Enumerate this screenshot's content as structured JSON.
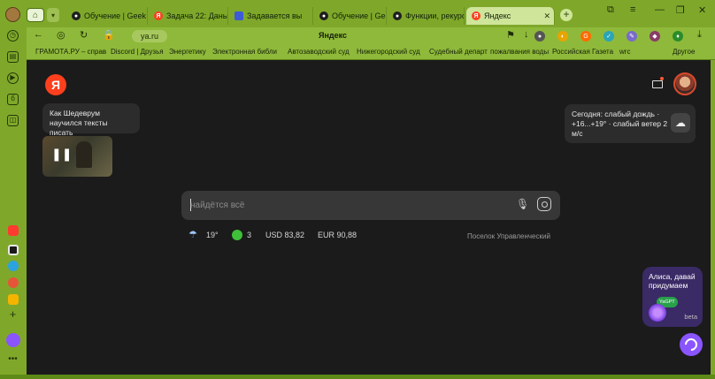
{
  "tabs": [
    {
      "label": "Обучение | Geek",
      "fav": "eg",
      "color": "#1e1e1e"
    },
    {
      "label": "Задача 22: Даны",
      "fav": "Я",
      "color": "#fc3f1d"
    },
    {
      "label": "Задавается вы",
      "fav": "■",
      "color": "#3d5bd6"
    },
    {
      "label": "Обучение | Geek",
      "fav": "eg",
      "color": "#1e1e1e"
    },
    {
      "label": "Функции, рекурс",
      "fav": "eg",
      "color": "#1e1e1e"
    },
    {
      "label": "Яндекс",
      "fav": "Я",
      "color": "#fc3f1d"
    }
  ],
  "address": {
    "url": "ya.ru",
    "title": "Яндекс"
  },
  "bookmarks": [
    "ГРАМОТА.РУ – справ",
    "Discord | Друзья",
    "Энергетику",
    "Электронная библи",
    "Автозаводский суд",
    "Нижегородский суд",
    "Судебный департ",
    "пожалвания воды",
    "Российская Газета",
    "wrc",
    "Другое"
  ],
  "story": {
    "text": "Как Шедеврум научился тексты писать"
  },
  "weather_card": {
    "text": "Сегодня: слабый дождь · +16...+19° · слабый ветер 2 м/с"
  },
  "search": {
    "placeholder": "найдётся всё"
  },
  "info": {
    "temp": "19°",
    "traffic": "3",
    "usd": "USD 83,82",
    "eur": "EUR 90,88",
    "place": "Поселок Управленческий"
  },
  "alice": {
    "text": "Алиса, давай придумаем",
    "badge": "YaGPT",
    "beta": "beta"
  }
}
